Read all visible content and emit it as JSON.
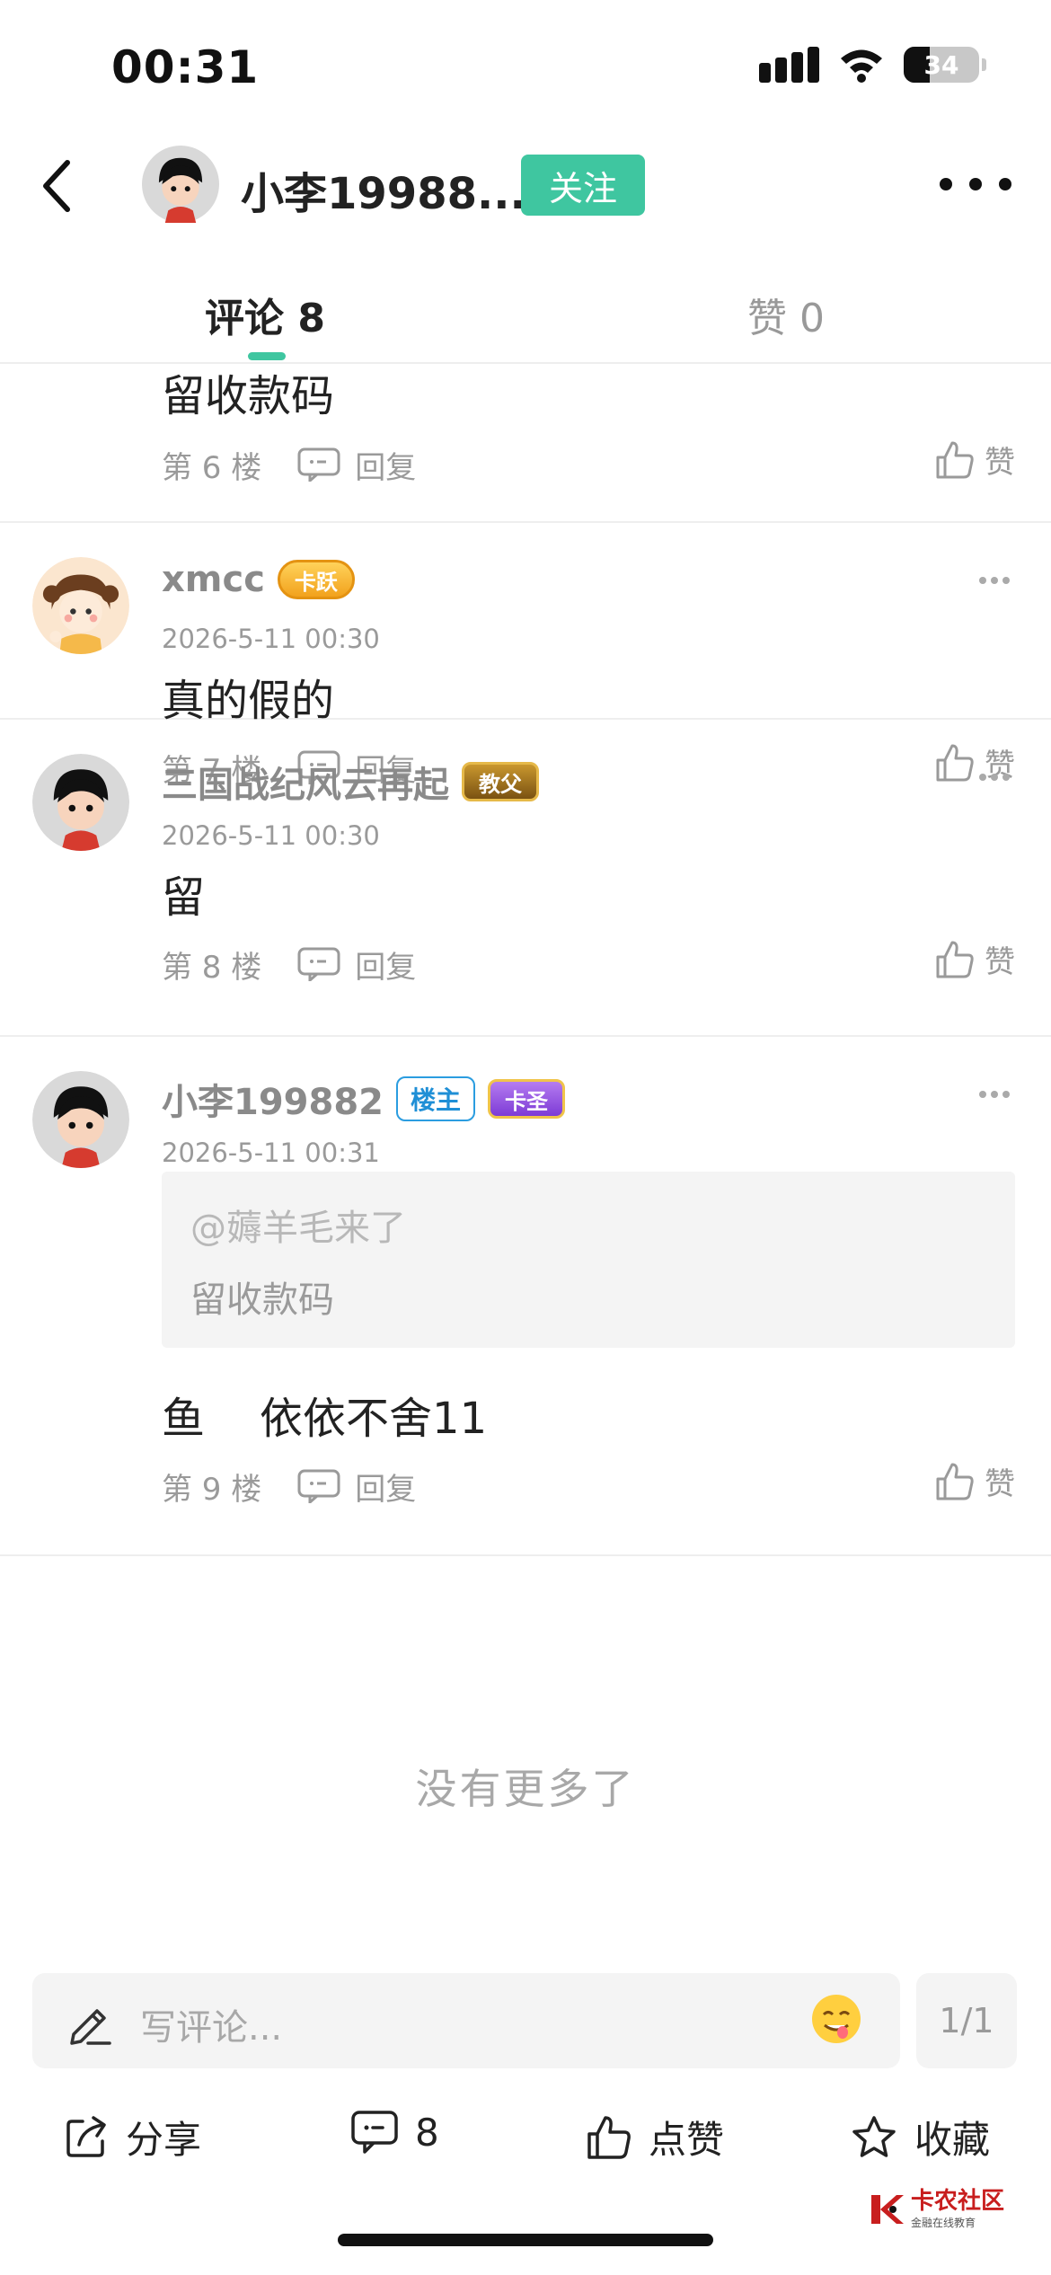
{
  "status_bar": {
    "time": "00:31",
    "battery": "34"
  },
  "header": {
    "name": "小李19988...",
    "follow_label": "关注"
  },
  "tabs": {
    "comments": "评论 8",
    "likes": "赞 0"
  },
  "comments": [
    {
      "text": "留收款码",
      "floor": "第 6 楼",
      "reply": "回复",
      "like": "赞"
    },
    {
      "user": "xmcc",
      "badge": "卡跃",
      "time": "2026-5-11 00:30",
      "text": "真的假的",
      "floor": "第 7 楼",
      "reply": "回复",
      "like": "赞"
    },
    {
      "user": "三国战纪风云再起",
      "badge": "教父",
      "time": "2026-5-11 00:30",
      "text": "留",
      "floor": "第 8 楼",
      "reply": "回复",
      "like": "赞"
    },
    {
      "user": "小李199882",
      "owner_badge": "楼主",
      "badge": "卡圣",
      "time": "2026-5-11 00:31",
      "quote_user": "@薅羊毛来了",
      "quote_text": "留收款码",
      "text": "鱼    依依不舍11",
      "floor": "第 9 楼",
      "reply": "回复",
      "like": "赞"
    }
  ],
  "no_more": "没有更多了",
  "input": {
    "placeholder": "写评论...",
    "page": "1/1"
  },
  "actions": {
    "share": "分享",
    "comment_count": "8",
    "like": "点赞",
    "favorite": "收藏"
  },
  "watermark": {
    "title": "卡农社区",
    "subtitle": "金融在线教育"
  },
  "colors": {
    "accent": "#3fc6a0",
    "owner_badge": "#1f8fd6",
    "watermark": "#c81e1e"
  }
}
